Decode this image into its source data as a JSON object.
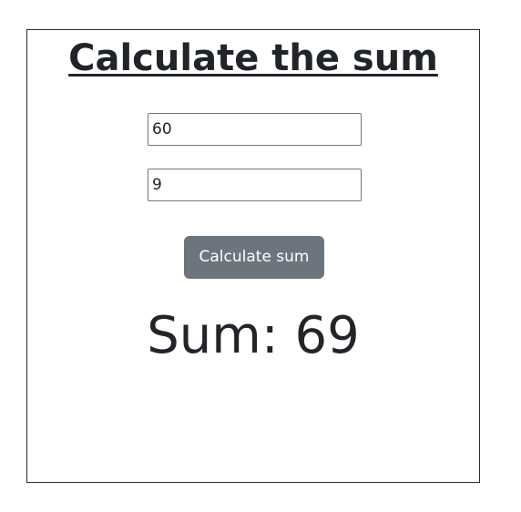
{
  "page": {
    "title": "Calculate the sum"
  },
  "form": {
    "first_value": "60",
    "second_value": "9",
    "button_label": "Calculate sum"
  },
  "result": {
    "text": "Sum: 69"
  },
  "colors": {
    "button_bg": "#6c757d",
    "text": "#212529",
    "border": "#2b2b2b"
  }
}
